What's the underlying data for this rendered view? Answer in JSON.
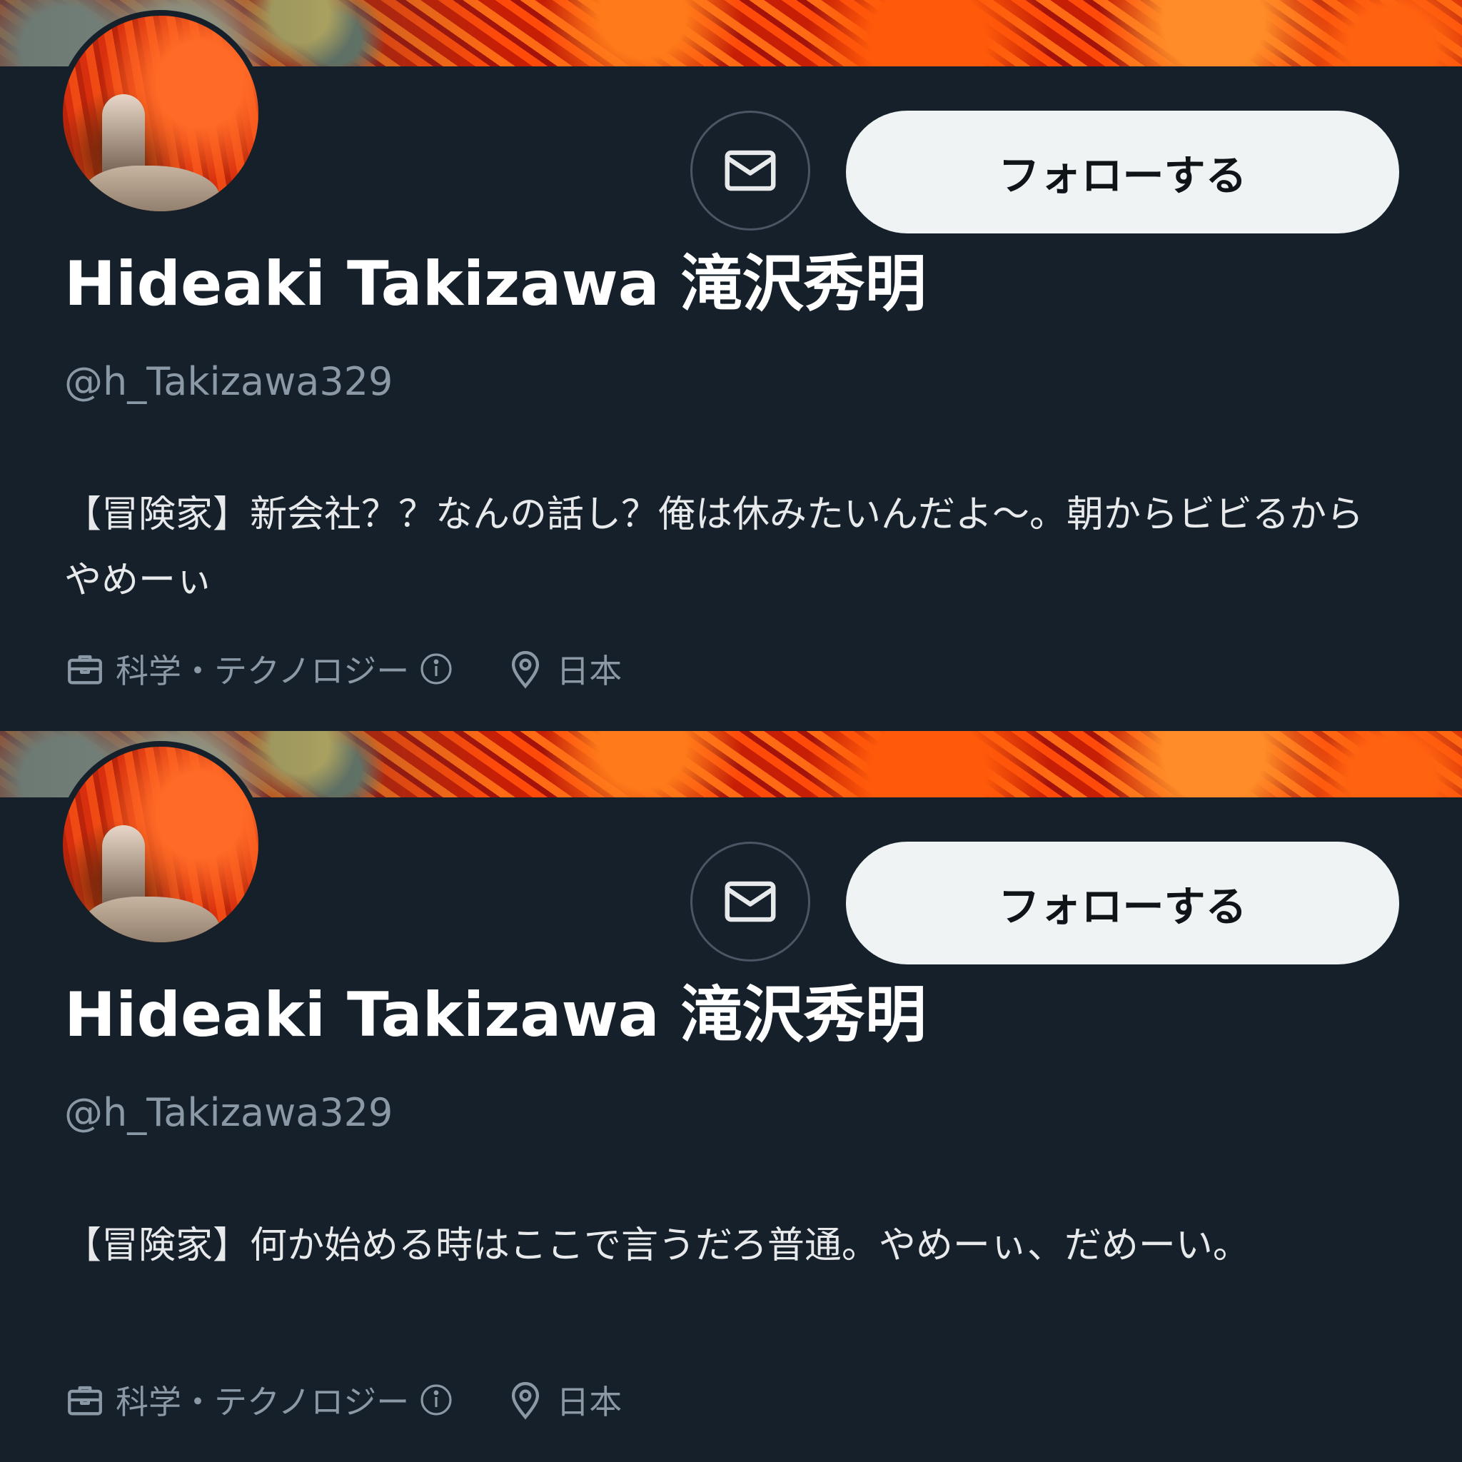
{
  "panels": [
    {
      "follow_label": "フォローする",
      "display_name": "Hideaki Takizawa 滝沢秀明",
      "handle": "@h_Takizawa329",
      "bio": "【冒険家】新会社？？なんの話し？俺は休みたいんだよ〜。朝からビビるからやめーぃ",
      "category": "科学・テクノロジー",
      "location": "日本"
    },
    {
      "follow_label": "フォローする",
      "display_name": "Hideaki Takizawa 滝沢秀明",
      "handle": "@h_Takizawa329",
      "bio": "【冒険家】何か始める時はここで言うだろ普通。やめーぃ、だめーい。",
      "category": "科学・テクノロジー",
      "location": "日本"
    }
  ],
  "icons": {
    "message": "envelope-icon",
    "category": "briefcase-icon",
    "info": "info-circle-icon",
    "location": "map-pin-icon"
  },
  "colors": {
    "background": "#15202b",
    "follow_button": "#eff3f4",
    "secondary_text": "#8b98a5"
  }
}
